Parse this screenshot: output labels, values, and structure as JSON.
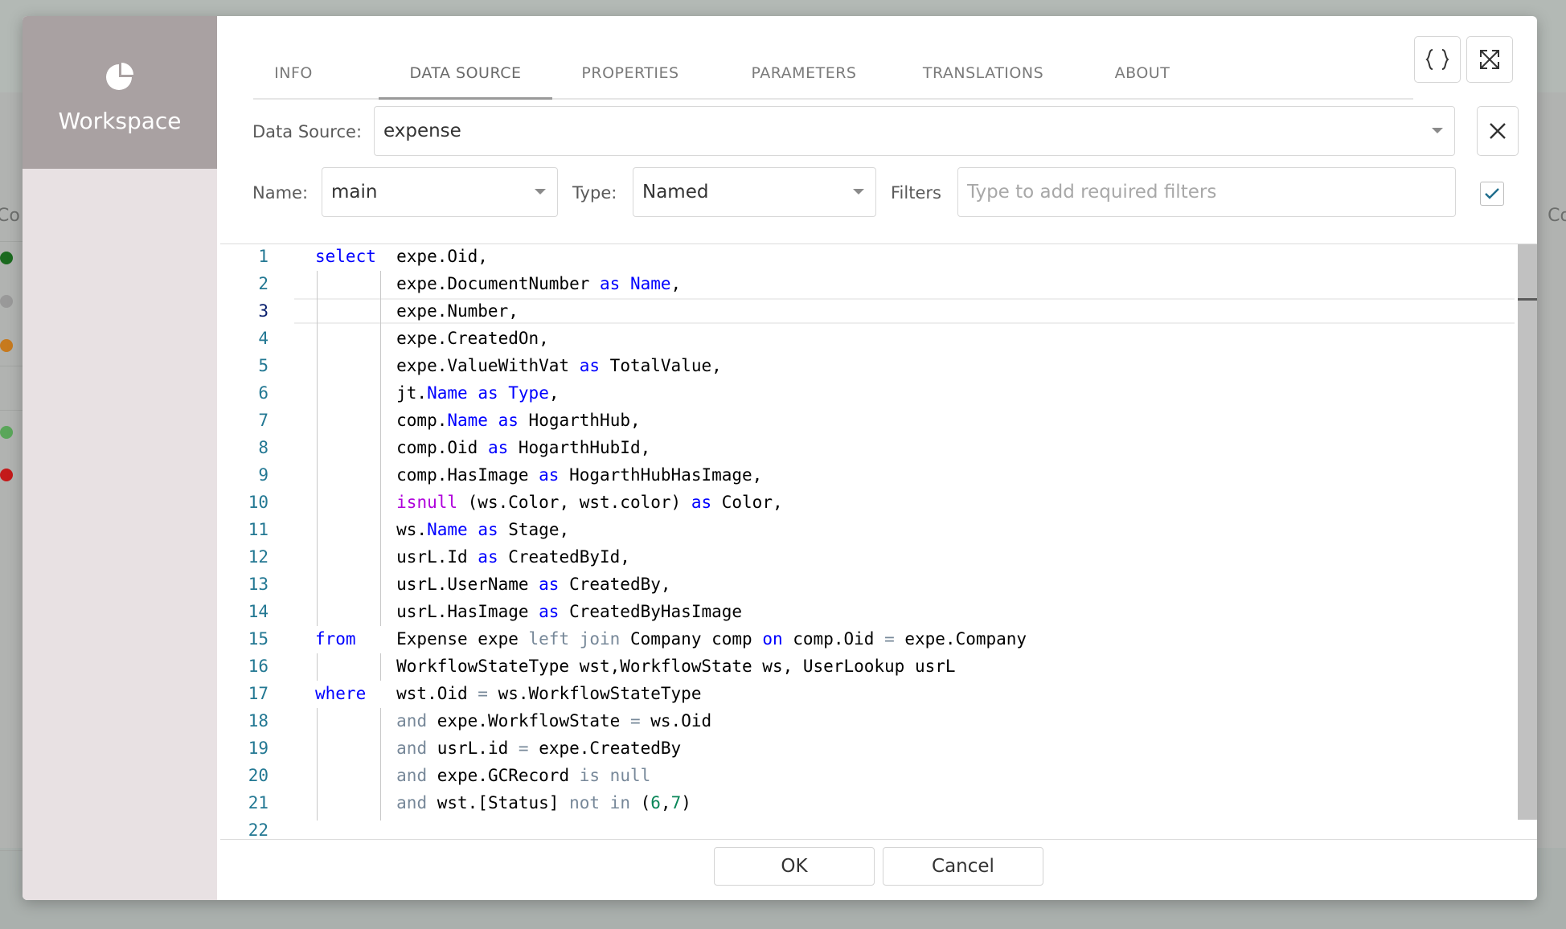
{
  "workspace": {
    "label": "Workspace",
    "icon": "pie-chart-icon"
  },
  "tabs": [
    {
      "label": "INFO",
      "active": false
    },
    {
      "label": "DATA SOURCE",
      "active": true
    },
    {
      "label": "PROPERTIES",
      "active": false
    },
    {
      "label": "PARAMETERS",
      "active": false
    },
    {
      "label": "TRANSLATIONS",
      "active": false
    },
    {
      "label": "ABOUT",
      "active": false
    }
  ],
  "toolbar": {
    "format_icon": "braces-icon",
    "expand_icon": "expand-icon"
  },
  "datasource": {
    "label": "Data Source:",
    "value": "expense",
    "clear_icon": "close-icon"
  },
  "name": {
    "label": "Name:",
    "value": "main"
  },
  "type": {
    "label": "Type:",
    "value": "Named"
  },
  "filters": {
    "label": "Filters",
    "placeholder": "Type to add required filters",
    "checked": true
  },
  "editor": {
    "current_line": 3,
    "lines": [
      {
        "n": "1",
        "tokens": [
          [
            "kw",
            "select"
          ],
          [
            "t",
            "  expe.Oid,"
          ]
        ]
      },
      {
        "n": "2",
        "tokens": [
          [
            "t",
            "        expe.DocumentNumber "
          ],
          [
            "kw",
            "as"
          ],
          [
            "t",
            " "
          ],
          [
            "kw",
            "Name"
          ],
          [
            "t",
            ","
          ]
        ]
      },
      {
        "n": "3",
        "tokens": [
          [
            "t",
            "        expe.Number,"
          ]
        ]
      },
      {
        "n": "4",
        "tokens": [
          [
            "t",
            "        expe.CreatedOn,"
          ]
        ]
      },
      {
        "n": "5",
        "tokens": [
          [
            "t",
            "        expe.ValueWithVat "
          ],
          [
            "kw",
            "as"
          ],
          [
            "t",
            " TotalValue,"
          ]
        ]
      },
      {
        "n": "6",
        "tokens": [
          [
            "t",
            "        jt."
          ],
          [
            "kw",
            "Name"
          ],
          [
            "t",
            " "
          ],
          [
            "kw",
            "as"
          ],
          [
            "t",
            " "
          ],
          [
            "kw",
            "Type"
          ],
          [
            "t",
            ","
          ]
        ]
      },
      {
        "n": "7",
        "tokens": [
          [
            "t",
            "        comp."
          ],
          [
            "kw",
            "Name"
          ],
          [
            "t",
            " "
          ],
          [
            "kw",
            "as"
          ],
          [
            "t",
            " HogarthHub,"
          ]
        ]
      },
      {
        "n": "8",
        "tokens": [
          [
            "t",
            "        comp.Oid "
          ],
          [
            "kw",
            "as"
          ],
          [
            "t",
            " HogarthHubId,"
          ]
        ]
      },
      {
        "n": "9",
        "tokens": [
          [
            "t",
            "        comp.HasImage "
          ],
          [
            "kw",
            "as"
          ],
          [
            "t",
            " HogarthHubHasImage,"
          ]
        ]
      },
      {
        "n": "10",
        "tokens": [
          [
            "t",
            "        "
          ],
          [
            "fn",
            "isnull"
          ],
          [
            "t",
            " (ws.Color, wst.color) "
          ],
          [
            "kw",
            "as"
          ],
          [
            "t",
            " Color,"
          ]
        ]
      },
      {
        "n": "11",
        "tokens": [
          [
            "t",
            "        ws."
          ],
          [
            "kw",
            "Name"
          ],
          [
            "t",
            " "
          ],
          [
            "kw",
            "as"
          ],
          [
            "t",
            " Stage,"
          ]
        ]
      },
      {
        "n": "12",
        "tokens": [
          [
            "t",
            "        usrL.Id "
          ],
          [
            "kw",
            "as"
          ],
          [
            "t",
            " CreatedById,"
          ]
        ]
      },
      {
        "n": "13",
        "tokens": [
          [
            "t",
            "        usrL.UserName "
          ],
          [
            "kw",
            "as"
          ],
          [
            "t",
            " CreatedBy,"
          ]
        ]
      },
      {
        "n": "14",
        "tokens": [
          [
            "t",
            "        usrL.HasImage "
          ],
          [
            "kw",
            "as"
          ],
          [
            "t",
            " CreatedByHasImage"
          ]
        ]
      },
      {
        "n": "15",
        "tokens": [
          [
            "kw",
            "from"
          ],
          [
            "t",
            "    Expense expe "
          ],
          [
            "op",
            "left join"
          ],
          [
            "t",
            " Company comp "
          ],
          [
            "kw",
            "on"
          ],
          [
            "t",
            " comp.Oid "
          ],
          [
            "op",
            "="
          ],
          [
            "t",
            " expe.Company"
          ]
        ]
      },
      {
        "n": "16",
        "tokens": [
          [
            "t",
            "        WorkflowStateType wst,WorkflowState ws, UserLookup usrL"
          ]
        ]
      },
      {
        "n": "17",
        "tokens": [
          [
            "kw",
            "where"
          ],
          [
            "t",
            "   wst.Oid "
          ],
          [
            "op",
            "="
          ],
          [
            "t",
            " ws.WorkflowStateType"
          ]
        ]
      },
      {
        "n": "18",
        "tokens": [
          [
            "t",
            "        "
          ],
          [
            "op",
            "and"
          ],
          [
            "t",
            " expe.WorkflowState "
          ],
          [
            "op",
            "="
          ],
          [
            "t",
            " ws.Oid"
          ]
        ]
      },
      {
        "n": "19",
        "tokens": [
          [
            "t",
            "        "
          ],
          [
            "op",
            "and"
          ],
          [
            "t",
            " usrL.id "
          ],
          [
            "op",
            "="
          ],
          [
            "t",
            " expe.CreatedBy"
          ]
        ]
      },
      {
        "n": "20",
        "tokens": [
          [
            "t",
            "        "
          ],
          [
            "op",
            "and"
          ],
          [
            "t",
            " expe.GCRecord "
          ],
          [
            "op",
            "is null"
          ]
        ]
      },
      {
        "n": "21",
        "tokens": [
          [
            "t",
            "        "
          ],
          [
            "op",
            "and"
          ],
          [
            "t",
            " wst.[Status] "
          ],
          [
            "op",
            "not in"
          ],
          [
            "t",
            " ("
          ],
          [
            "num",
            "6"
          ],
          [
            "t",
            ","
          ],
          [
            "num",
            "7"
          ],
          [
            "t",
            ")"
          ]
        ]
      },
      {
        "n": "22",
        "tokens": []
      }
    ]
  },
  "footer": {
    "ok_label": "OK",
    "cancel_label": "Cancel"
  },
  "colors": {
    "accent": "#1f6d8c",
    "sidebar_head": "#a9a1a2",
    "sidebar": "#e8e1e3"
  }
}
